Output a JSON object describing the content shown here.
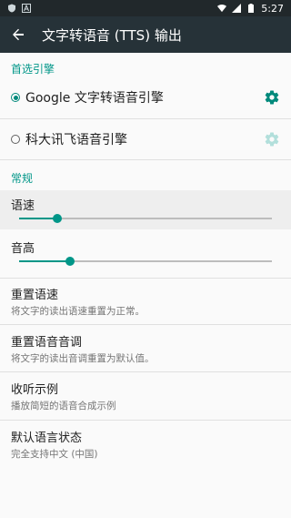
{
  "status_bar": {
    "time": "5:27",
    "icons": [
      "shield-icon",
      "notification-a-icon",
      "wifi-icon",
      "signal-icon",
      "battery-icon"
    ]
  },
  "toolbar": {
    "back_icon": "arrow-left-icon",
    "title": "文字转语音 (TTS) 输出"
  },
  "preferred_engine": {
    "section_title": "首选引擎",
    "engines": [
      {
        "label": "Google 文字转语音引擎",
        "selected": true,
        "settings_icon": "gear-icon",
        "settings_enabled": true
      },
      {
        "label": "科大讯飞语音引擎",
        "selected": false,
        "settings_icon": "gear-icon",
        "settings_enabled": false
      }
    ]
  },
  "general": {
    "section_title": "常规",
    "speech_rate": {
      "label": "语速",
      "value_fraction": 0.15
    },
    "pitch": {
      "label": "音高",
      "value_fraction": 0.2
    },
    "items": [
      {
        "title": "重置语速",
        "summary": "将文字的读出语速重置为正常。"
      },
      {
        "title": "重置语音音调",
        "summary": "将文字的读出音调重置为默认值。"
      },
      {
        "title": "收听示例",
        "summary": "播放简短的语音合成示例"
      },
      {
        "title": "默认语言状态",
        "summary": "完全支持中文 (中国)"
      }
    ]
  },
  "colors": {
    "accent": "#009688",
    "toolbar": "#263238",
    "statusbar": "#21282b",
    "background": "#fafafa"
  }
}
